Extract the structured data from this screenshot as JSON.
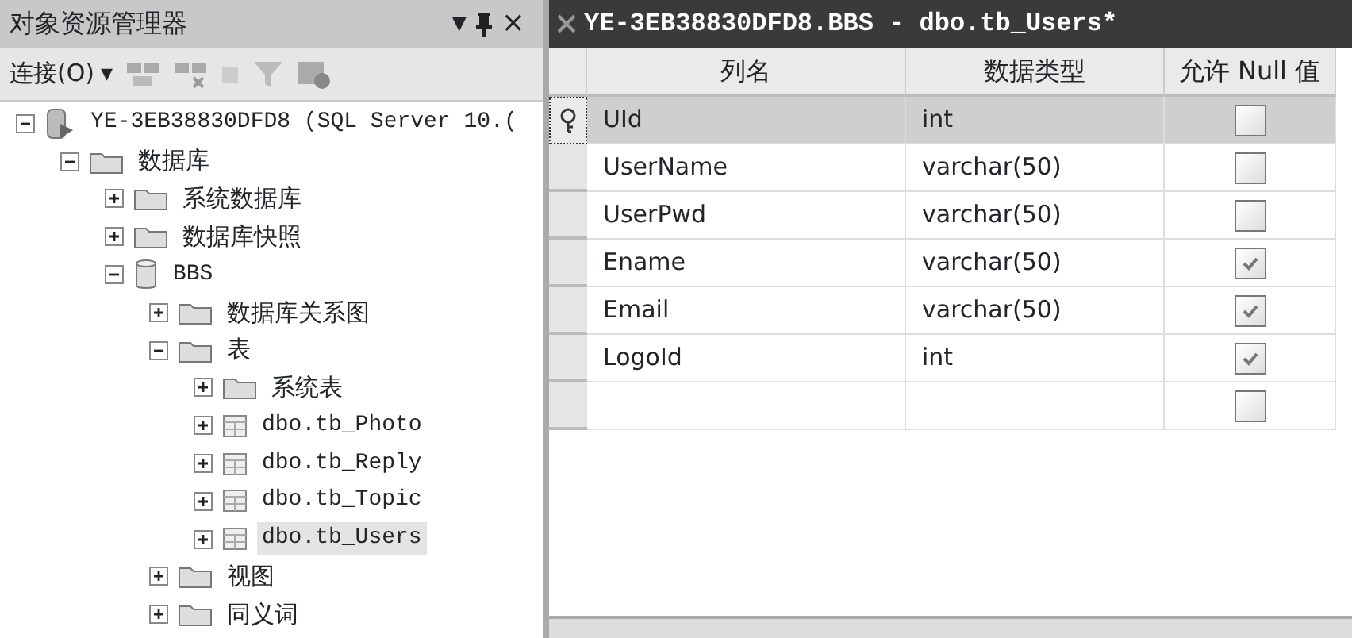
{
  "explorer": {
    "title": "对象资源管理器",
    "dropdown_glyph": "▾",
    "close_glyph": "×",
    "connect_label": "连接(O)",
    "connect_caret": "▾",
    "tree": [
      {
        "label": "YE-3EB38830DFD8 (SQL Server 10.(",
        "kind": "server",
        "expanded": true,
        "selected": false,
        "children": [
          {
            "label": "数据库",
            "kind": "folder",
            "expanded": true,
            "selected": false,
            "children": [
              {
                "label": "系统数据库",
                "kind": "folder",
                "expanded": false,
                "selected": false
              },
              {
                "label": "数据库快照",
                "kind": "folder",
                "expanded": false,
                "selected": false
              },
              {
                "label": "BBS",
                "kind": "database",
                "expanded": true,
                "selected": false,
                "children": [
                  {
                    "label": "数据库关系图",
                    "kind": "folder",
                    "expanded": false,
                    "selected": false
                  },
                  {
                    "label": "表",
                    "kind": "folder",
                    "expanded": true,
                    "selected": false,
                    "children": [
                      {
                        "label": "系统表",
                        "kind": "folder",
                        "expanded": false,
                        "selected": false
                      },
                      {
                        "label": "dbo.tb_Photo",
                        "kind": "table",
                        "expanded": false,
                        "selected": false
                      },
                      {
                        "label": "dbo.tb_Reply",
                        "kind": "table",
                        "expanded": false,
                        "selected": false
                      },
                      {
                        "label": "dbo.tb_Topic",
                        "kind": "table",
                        "expanded": false,
                        "selected": false
                      },
                      {
                        "label": "dbo.tb_Users",
                        "kind": "table",
                        "expanded": false,
                        "selected": true
                      }
                    ]
                  },
                  {
                    "label": "视图",
                    "kind": "folder",
                    "expanded": false,
                    "selected": false
                  },
                  {
                    "label": "同义词",
                    "kind": "folder",
                    "expanded": false,
                    "selected": false
                  }
                ]
              }
            ]
          }
        ]
      }
    ]
  },
  "designer": {
    "title": "YE-3EB38830DFD8.BBS - dbo.tb_Users*",
    "columns": [
      "列名",
      "数据类型",
      "允许 Null 值"
    ],
    "rows": [
      {
        "name": "UId",
        "type": "int",
        "allow_null": false,
        "key": true,
        "selected": true
      },
      {
        "name": "UserName",
        "type": "varchar(50)",
        "allow_null": false,
        "key": false,
        "selected": false
      },
      {
        "name": "UserPwd",
        "type": "varchar(50)",
        "allow_null": false,
        "key": false,
        "selected": false
      },
      {
        "name": "Ename",
        "type": "varchar(50)",
        "allow_null": true,
        "key": false,
        "selected": false
      },
      {
        "name": "Email",
        "type": "varchar(50)",
        "allow_null": true,
        "key": false,
        "selected": false
      },
      {
        "name": "LogoId",
        "type": "int",
        "allow_null": true,
        "key": false,
        "selected": false
      },
      {
        "name": "",
        "type": "",
        "allow_null": false,
        "key": false,
        "selected": false
      }
    ]
  }
}
